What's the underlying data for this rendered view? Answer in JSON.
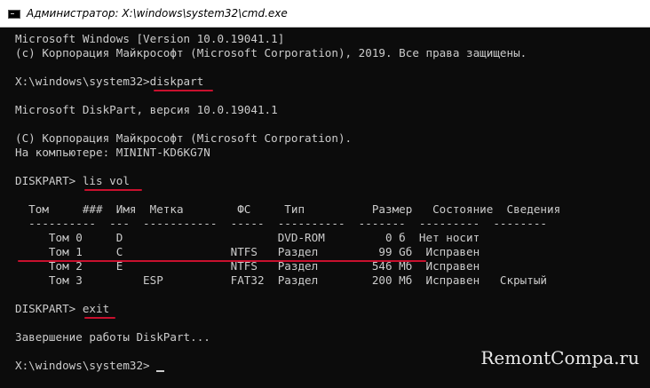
{
  "window": {
    "title": "Администратор: X:\\windows\\system32\\cmd.exe",
    "icon": "cmd-icon"
  },
  "console": {
    "lines": [
      "Microsoft Windows [Version 10.0.19041.1]",
      "(c) Корпорация Майкрософт (Microsoft Corporation), 2019. Все права защищены.",
      "",
      "X:\\windows\\system32>diskpart",
      "",
      "Microsoft DiskPart, версия 10.0.19041.1",
      "",
      "(C) Корпорация Майкрософт (Microsoft Corporation).",
      "На компьютере: MININT-KD6KG7N",
      "",
      "DISKPART> lis vol",
      "",
      "  Том     ###  Имя  Метка        ФС     Тип          Размер   Состояние  Сведения",
      "  ----------  ---  -----------  -----  ----------  -------  ---------  --------",
      "     Том 0     D                       DVD-ROM         0 б  Нет носит",
      "     Том 1     C                NTFS   Раздел         99 Gб  Исправен",
      "     Том 2     E                NTFS   Раздел        546 Мб  Исправен",
      "     Том 3         ESP          FAT32  Раздел        200 Мб  Исправен   Скрытый",
      "",
      "DISKPART> exit",
      "",
      "Завершение работы DiskPart...",
      "",
      "X:\\windows\\system32>"
    ]
  },
  "watermark": "RemontCompa.ru",
  "colors": {
    "console_background": "#0c0c0c",
    "console_text": "#cccccc",
    "highlight_underline": "#c8102e",
    "titlebar": "#ffffff"
  }
}
